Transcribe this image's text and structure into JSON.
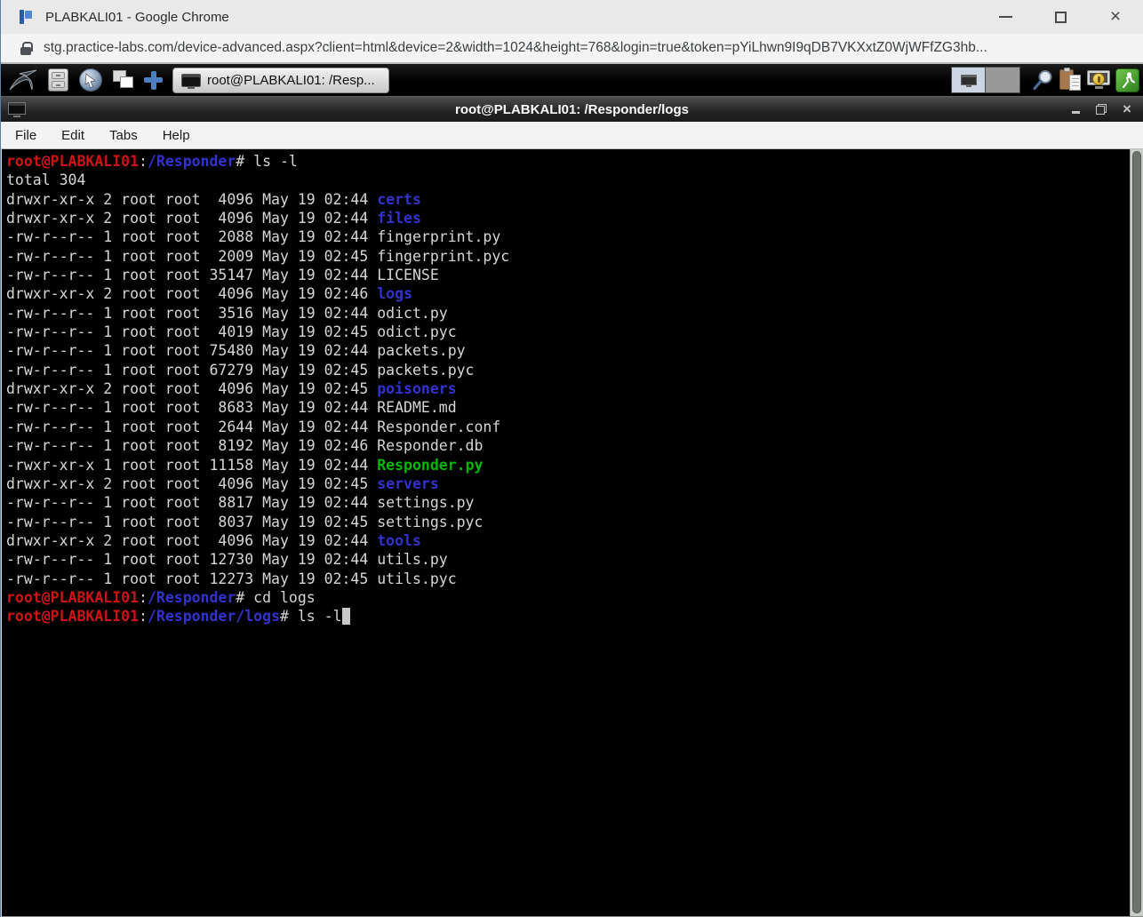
{
  "browser": {
    "window_title": "PLABKALI01 - Google Chrome",
    "url": "stg.practice-labs.com/device-advanced.aspx?client=html&device=2&width=1024&height=768&login=true&token=pYiLhwn9I9qDB7VKXxtZ0WjWFfZG3hb...",
    "controls": {
      "minimize": "minimize",
      "maximize": "maximize",
      "close": "×"
    }
  },
  "taskbar": {
    "window_tab": {
      "label": "root@PLABKALI01: /Resp..."
    },
    "left_icons": [
      "kali-logo",
      "file-manager",
      "web-browser",
      "window-list",
      "add-launcher"
    ],
    "right_icons": [
      "workspace-pager",
      "magnifier",
      "clipboard",
      "keyring",
      "logout"
    ]
  },
  "terminal": {
    "window_title": "root@PLABKALI01: /Responder/logs",
    "controls": {
      "minimize": "minimize",
      "restore": "restore",
      "close": "×"
    },
    "menu": [
      "File",
      "Edit",
      "Tabs",
      "Help"
    ],
    "colors": {
      "background": "#000000",
      "text": "#d6d6d6",
      "prompt_user": "#cd1414",
      "directory_blue": "#3232cc",
      "executable_green": "#00b800",
      "cursor": "#c8c8c8"
    },
    "lines": [
      [
        [
          "u",
          "root@PLABKALI01"
        ],
        [
          "pt",
          ":"
        ],
        [
          "dir",
          "/Responder"
        ],
        [
          "pt",
          "# ls -l"
        ]
      ],
      [
        [
          "pt",
          "total 304"
        ]
      ],
      [
        [
          "pt",
          "drwxr-xr-x 2 root root  4096 May 19 02:44 "
        ],
        [
          "dir",
          "certs"
        ]
      ],
      [
        [
          "pt",
          "drwxr-xr-x 2 root root  4096 May 19 02:44 "
        ],
        [
          "dir",
          "files"
        ]
      ],
      [
        [
          "pt",
          "-rw-r--r-- 1 root root  2088 May 19 02:44 fingerprint.py"
        ]
      ],
      [
        [
          "pt",
          "-rw-r--r-- 1 root root  2009 May 19 02:45 fingerprint.pyc"
        ]
      ],
      [
        [
          "pt",
          "-rw-r--r-- 1 root root 35147 May 19 02:44 LICENSE"
        ]
      ],
      [
        [
          "pt",
          "drwxr-xr-x 2 root root  4096 May 19 02:46 "
        ],
        [
          "dir",
          "logs"
        ]
      ],
      [
        [
          "pt",
          "-rw-r--r-- 1 root root  3516 May 19 02:44 odict.py"
        ]
      ],
      [
        [
          "pt",
          "-rw-r--r-- 1 root root  4019 May 19 02:45 odict.pyc"
        ]
      ],
      [
        [
          "pt",
          "-rw-r--r-- 1 root root 75480 May 19 02:44 packets.py"
        ]
      ],
      [
        [
          "pt",
          "-rw-r--r-- 1 root root 67279 May 19 02:45 packets.pyc"
        ]
      ],
      [
        [
          "pt",
          "drwxr-xr-x 2 root root  4096 May 19 02:45 "
        ],
        [
          "dir",
          "poisoners"
        ]
      ],
      [
        [
          "pt",
          "-rw-r--r-- 1 root root  8683 May 19 02:44 README.md"
        ]
      ],
      [
        [
          "pt",
          "-rw-r--r-- 1 root root  2644 May 19 02:44 Responder.conf"
        ]
      ],
      [
        [
          "pt",
          "-rw-r--r-- 1 root root  8192 May 19 02:46 Responder.db"
        ]
      ],
      [
        [
          "pt",
          "-rwxr-xr-x 1 root root 11158 May 19 02:44 "
        ],
        [
          "exe",
          "Responder.py"
        ]
      ],
      [
        [
          "pt",
          "drwxr-xr-x 2 root root  4096 May 19 02:45 "
        ],
        [
          "dir",
          "servers"
        ]
      ],
      [
        [
          "pt",
          "-rw-r--r-- 1 root root  8817 May 19 02:44 settings.py"
        ]
      ],
      [
        [
          "pt",
          "-rw-r--r-- 1 root root  8037 May 19 02:45 settings.pyc"
        ]
      ],
      [
        [
          "pt",
          "drwxr-xr-x 2 root root  4096 May 19 02:44 "
        ],
        [
          "dir",
          "tools"
        ]
      ],
      [
        [
          "pt",
          "-rw-r--r-- 1 root root 12730 May 19 02:44 utils.py"
        ]
      ],
      [
        [
          "pt",
          "-rw-r--r-- 1 root root 12273 May 19 02:45 utils.pyc"
        ]
      ],
      [
        [
          "u",
          "root@PLABKALI01"
        ],
        [
          "pt",
          ":"
        ],
        [
          "dir",
          "/Responder"
        ],
        [
          "pt",
          "# cd logs"
        ]
      ],
      [
        [
          "u",
          "root@PLABKALI01"
        ],
        [
          "pt",
          ":"
        ],
        [
          "dir",
          "/Responder/logs"
        ],
        [
          "pt",
          "# ls -l"
        ],
        [
          "cur",
          " "
        ]
      ]
    ]
  }
}
